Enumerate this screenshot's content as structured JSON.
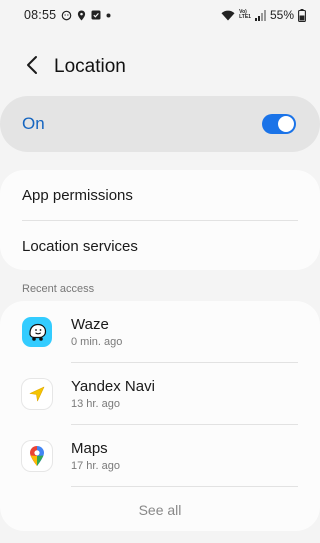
{
  "status_bar": {
    "time": "08:55",
    "volte_top": "Vo)",
    "volte_bottom": "LTE1",
    "battery": "55%"
  },
  "header": {
    "title": "Location",
    "back_icon": "chevron-left-icon"
  },
  "master_switch": {
    "label": "On",
    "state": true,
    "accent": "#1a73e8"
  },
  "settings_items": [
    {
      "label": "App permissions"
    },
    {
      "label": "Location services"
    }
  ],
  "recent": {
    "section_title": "Recent access",
    "apps": [
      {
        "name": "Waze",
        "time": "0 min. ago",
        "icon": "waze-icon"
      },
      {
        "name": "Yandex Navi",
        "time": "13 hr. ago",
        "icon": "yandex-navi-icon"
      },
      {
        "name": "Maps",
        "time": "17 hr. ago",
        "icon": "google-maps-icon"
      }
    ],
    "see_all": "See all"
  }
}
